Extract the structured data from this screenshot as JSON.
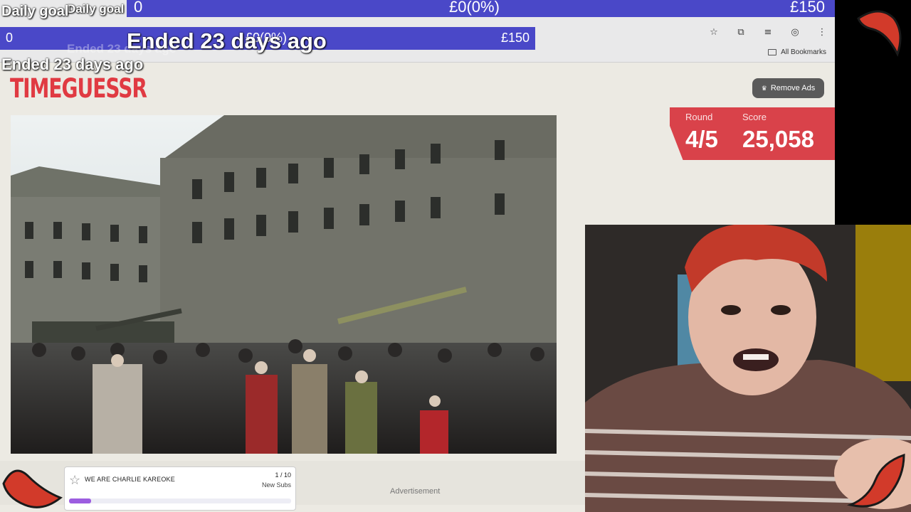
{
  "overlay": {
    "goal_title": "Daily goal",
    "goal_current": "0",
    "goal_progress": "£0(0%)",
    "goal_target": "£150",
    "goal_status": "Ended 23 days ago",
    "goal_status_large": "Ended 23 days ago",
    "bar2_current": "0",
    "bar2_progress": "£0(0%)",
    "bar2_target": "£150"
  },
  "browser": {
    "bookmarks_label": "All Bookmarks"
  },
  "game": {
    "logo": "TIMEGUESSR",
    "remove_ads_label": "Remove Ads",
    "round_label": "Round",
    "round_value": "4/5",
    "score_label": "Score",
    "score_value": "25,058",
    "advertisement_label": "Advertisement"
  },
  "sub_goal": {
    "title": "WE ARE CHARLIE KAREOKE",
    "count": "1 / 10",
    "label": "New Subs",
    "progress": 0.1
  },
  "colors": {
    "goal_bar": "#4a48c8",
    "brand_red": "#e03a42",
    "score_panel": "#d9424a",
    "progress_fill": "#9c5de0"
  },
  "icons": [
    "star-icon",
    "bookmark-star-icon",
    "extensions-icon",
    "media-icon",
    "profile-icon",
    "menu-icon",
    "folder-icon",
    "crown-icon",
    "chili-icon"
  ]
}
